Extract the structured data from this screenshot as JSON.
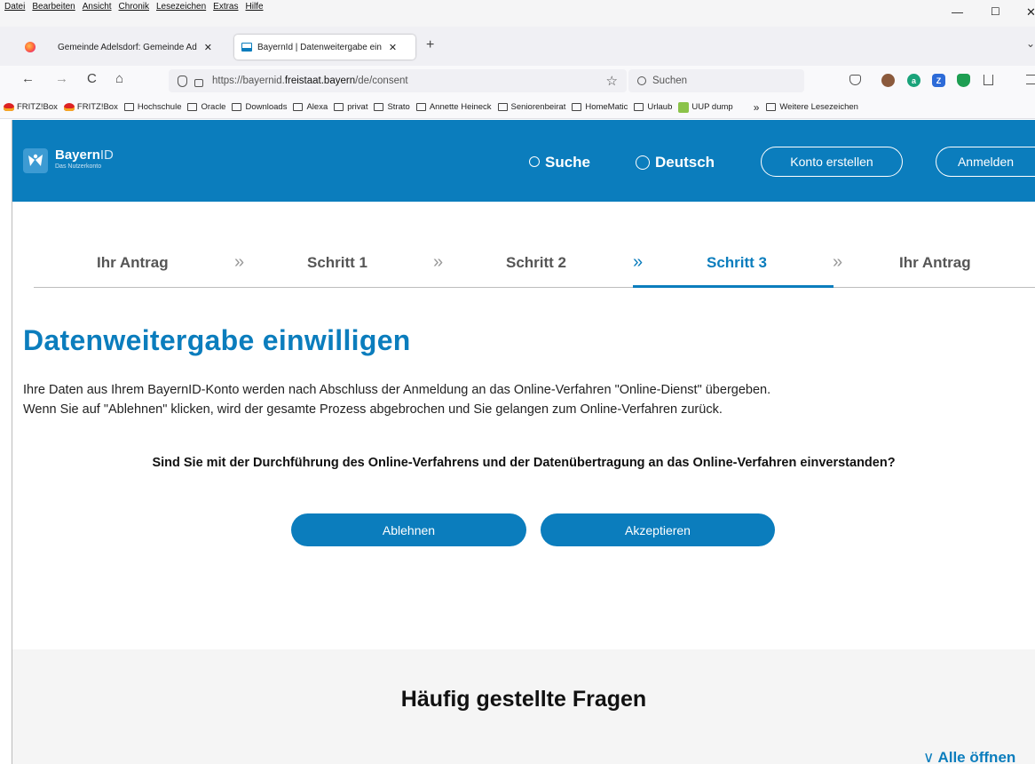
{
  "menubar": {
    "items": [
      "Datei",
      "Bearbeiten",
      "Ansicht",
      "Chronik",
      "Lesezeichen",
      "Extras",
      "Hilfe"
    ],
    "minimize": "—",
    "maximize": "☐",
    "close": "✕"
  },
  "tabs": [
    {
      "label": "Gemeinde Adelsdorf: Gemeinde Ad",
      "close": "✕"
    },
    {
      "label": "BayernId | Datenweitergabe ein",
      "close": "✕"
    }
  ],
  "new_tab": "+",
  "tab_overflow": "⌄",
  "nav": {
    "back": "←",
    "forward": "→",
    "reload": "C",
    "home": "⌂",
    "url_prefix": "https://bayernid.",
    "url_host": "freistaat.bayern",
    "url_path": "/de/consent",
    "bookmark_star": "☆",
    "search_placeholder": "Suchen"
  },
  "bookmarks": [
    {
      "label": "FRITZ!Box",
      "icon": "fritz-icon"
    },
    {
      "label": "FRITZ!Box",
      "icon": "fritz-icon"
    },
    {
      "label": "Hochschule",
      "icon": "folder-icon"
    },
    {
      "label": "Oracle",
      "icon": "folder-icon"
    },
    {
      "label": "Downloads",
      "icon": "folder-icon"
    },
    {
      "label": "Alexa",
      "icon": "folder-icon"
    },
    {
      "label": "privat",
      "icon": "folder-icon"
    },
    {
      "label": "Strato",
      "icon": "folder-icon"
    },
    {
      "label": "Annette Heineck",
      "icon": "folder-icon"
    },
    {
      "label": "Seniorenbeirat",
      "icon": "folder-icon"
    },
    {
      "label": "HomeMatic",
      "icon": "folder-icon"
    },
    {
      "label": "Urlaub",
      "icon": "folder-icon"
    },
    {
      "label": "UUP dump",
      "icon": "uup-icon"
    }
  ],
  "bookmarks_more": "»",
  "bookmarks_other": "Weitere Lesezeichen",
  "header": {
    "logo_bold": "Bayern",
    "logo_thin": "ID",
    "logo_sub": "Das Nutzerkonto",
    "search_label": "Suche",
    "language_label": "Deutsch",
    "register_label": "Konto erstellen",
    "login_label": "Anmelden",
    "brand_color": "#0b7dbd"
  },
  "steps": [
    {
      "label": "Ihr Antrag",
      "active": false
    },
    {
      "label": "Schritt 1",
      "active": false
    },
    {
      "label": "Schritt 2",
      "active": false
    },
    {
      "label": "Schritt 3",
      "active": true
    },
    {
      "label": "Ihr Antrag",
      "active": false
    }
  ],
  "step_separator": "»",
  "main": {
    "title": "Datenweitergabe einwilligen",
    "intro_line1": "Ihre Daten aus Ihrem BayernID-Konto werden nach Abschluss der Anmeldung an das Online-Verfahren \"Online-Dienst\" übergeben.",
    "intro_line2": "Wenn Sie auf \"Ablehnen\" klicken, wird der gesamte Prozess abgebrochen und Sie gelangen zum Online-Verfahren zurück.",
    "question": "Sind Sie mit der Durchführung des Online-Verfahrens und der Datenübertragung an das Online-Verfahren einverstanden?",
    "reject_label": "Ablehnen",
    "accept_label": "Akzeptieren"
  },
  "faq": {
    "title": "Häufig gestellte Fragen",
    "open_all_label": "Alle öffnen",
    "open_all_chevron": "∨"
  }
}
